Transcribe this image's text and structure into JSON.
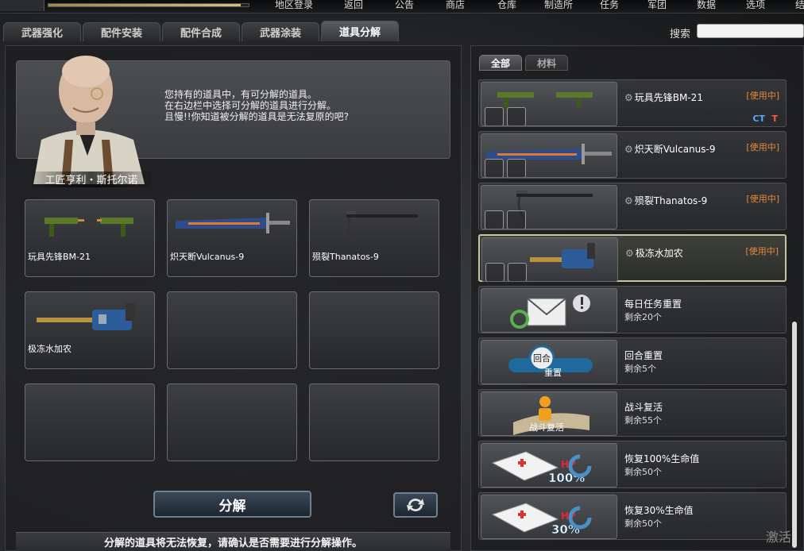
{
  "topbar": {
    "menu": [
      "地区登录",
      "返回",
      "公告",
      "商店",
      "仓库",
      "制造所",
      "任务",
      "军团",
      "数据",
      "选项",
      "结束"
    ]
  },
  "tabs": [
    "武器强化",
    "配件安装",
    "配件合成",
    "武器涂装",
    "道具分解"
  ],
  "active_tab": "道具分解",
  "search": {
    "label": "搜索",
    "value": ""
  },
  "npc": {
    "name": "工匠亨利・斯托尔诺",
    "lines": [
      "您持有的道具中，有可分解的道具。",
      "在右边栏中选择可分解的道具进行分解。",
      "且慢!!你知道被分解的道具是无法复原的吧?"
    ]
  },
  "slots": [
    {
      "label": "玩具先锋BM-21",
      "icon": "toy-smg-icon"
    },
    {
      "label": "炽天断Vulcanus-9",
      "icon": "greatsword-icon"
    },
    {
      "label": "殒裂Thanatos-9",
      "icon": "scythe-gun-icon"
    },
    {
      "label": "极冻水加农",
      "icon": "water-cannon-icon"
    },
    {
      "label": "",
      "icon": ""
    },
    {
      "label": "",
      "icon": ""
    },
    {
      "label": "",
      "icon": ""
    },
    {
      "label": "",
      "icon": ""
    },
    {
      "label": "",
      "icon": ""
    }
  ],
  "buttons": {
    "decompose": "分解",
    "refresh_icon": "refresh-icon"
  },
  "warning": "分解的道具将无法恢复，请确认是否需要进行分解操作。",
  "right_tabs": [
    "全部",
    "材料"
  ],
  "right_items": [
    {
      "name": "玩具先锋BM-21",
      "status": "[使用中]",
      "ct": "CT",
      "t": "T",
      "icon": "toy-smg-icon"
    },
    {
      "name": "炽天断Vulcanus-9",
      "status": "[使用中]",
      "icon": "greatsword-icon"
    },
    {
      "name": "殒裂Thanatos-9",
      "status": "[使用中]",
      "icon": "scythe-gun-icon"
    },
    {
      "name": "极冻水加农",
      "status": "[使用中]",
      "icon": "water-cannon-icon"
    },
    {
      "name": "每日任务重置",
      "sub": "剩余20个",
      "icon": "mail-reset-icon"
    },
    {
      "name": "回合重置",
      "sub": "剩余5个",
      "icon": "round-reset-icon",
      "thumb_text_1": "回合",
      "thumb_text_2": "重置"
    },
    {
      "name": "战斗复活",
      "sub": "剩余55个",
      "icon": "revive-icon",
      "thumb_text_1": "战斗复活"
    },
    {
      "name": "恢复100%生命值",
      "sub": "剩余50个",
      "icon": "medkit-icon",
      "thumb_text_1": "HP",
      "thumb_text_2": "100%"
    },
    {
      "name": "恢复30%生命值",
      "sub": "剩余50个",
      "icon": "medkit-icon",
      "thumb_text_1": "HP",
      "thumb_text_2": "30%"
    }
  ],
  "watermark": "激活",
  "colors": {
    "status": "#e8893a",
    "ct": "#5aa6ff",
    "t": "#ff5a3a",
    "accent_button": "#3b4856"
  }
}
